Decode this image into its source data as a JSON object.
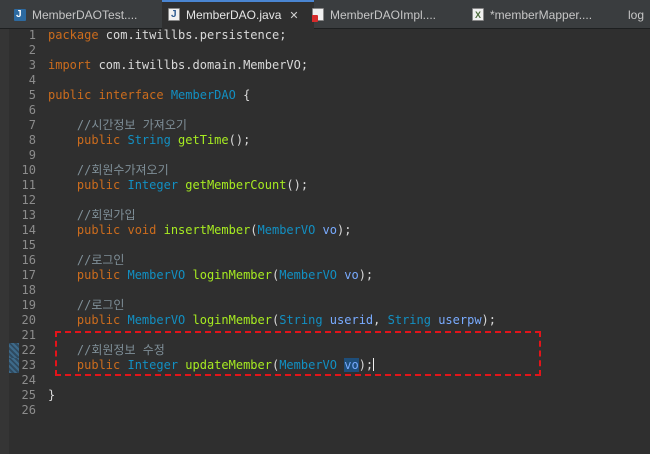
{
  "tabs": [
    {
      "label": "MemberDAOTest....",
      "icon": "junit-test-icon"
    },
    {
      "label": "MemberDAO.java",
      "icon": "java-file-icon",
      "active": true,
      "close": "✕"
    },
    {
      "label": "MemberDAOImpl....",
      "icon": "java-error-file-icon"
    },
    {
      "label": "*memberMapper....",
      "icon": "xml-file-icon"
    },
    {
      "label": "log",
      "icon": "log-file-icon"
    }
  ],
  "editor": {
    "line_numbers": [
      "1",
      "2",
      "3",
      "4",
      "5",
      "6",
      "7",
      "8",
      "9",
      "10",
      "11",
      "12",
      "13",
      "14",
      "15",
      "16",
      "17",
      "18",
      "19",
      "20",
      "21",
      "22",
      "23",
      "24",
      "25",
      "26"
    ],
    "code": {
      "l1_kw": "package",
      "l1_rest": " com.itwillbs.persistence;",
      "l3_kw": "import",
      "l3_rest": " com.itwillbs.domain.MemberVO;",
      "l5_kw1": "public",
      "l5_kw2": " interface",
      "l5_name": " MemberDAO",
      "l5_rest": " {",
      "l7_cm": "    //시간정보 가져오기",
      "l8_kw": "    public",
      "l8_ty": " String",
      "l8_fn": " getTime",
      "l8_rest": "();",
      "l10_cm": "    //회원수가져오기",
      "l11_kw": "    public",
      "l11_ty": " Integer",
      "l11_fn": " getMemberCount",
      "l11_rest": "();",
      "l13_cm": "    //회원가입",
      "l14_kw1": "    public",
      "l14_kw2": " void",
      "l14_fn": " insertMember",
      "l14_p1": "(",
      "l14_ty": "MemberVO",
      "l14_pa": " vo",
      "l14_rest": ");",
      "l16_cm": "    //로그인",
      "l17_kw": "    public",
      "l17_ty1": " MemberVO",
      "l17_fn": " loginMember",
      "l17_p1": "(",
      "l17_ty2": "MemberVO",
      "l17_pa": " vo",
      "l17_rest": ");",
      "l19_cm": "    //로그인",
      "l20_kw": "    public",
      "l20_ty1": " MemberVO",
      "l20_fn": " loginMember",
      "l20_p1": "(",
      "l20_ty2": "String",
      "l20_pa1": " userid",
      "l20_c": ",",
      "l20_ty3": " String",
      "l20_pa2": " userpw",
      "l20_rest": ");",
      "l22_cm": "    //회원정보 수정",
      "l23_kw": "    public",
      "l23_ty1": " Integer",
      "l23_fn": " updateMember",
      "l23_p1": "(",
      "l23_ty2": "MemberVO",
      "l23_sp": " ",
      "l23_pa": "vo",
      "l23_rest": ");",
      "l25_rest": "}"
    }
  },
  "colors": {
    "keyword": "#cc6c1d",
    "type": "#1290c3",
    "method": "#a7ec21",
    "comment": "#7f8f98",
    "param": "#79abff",
    "highlight_box": "#e3141a"
  }
}
